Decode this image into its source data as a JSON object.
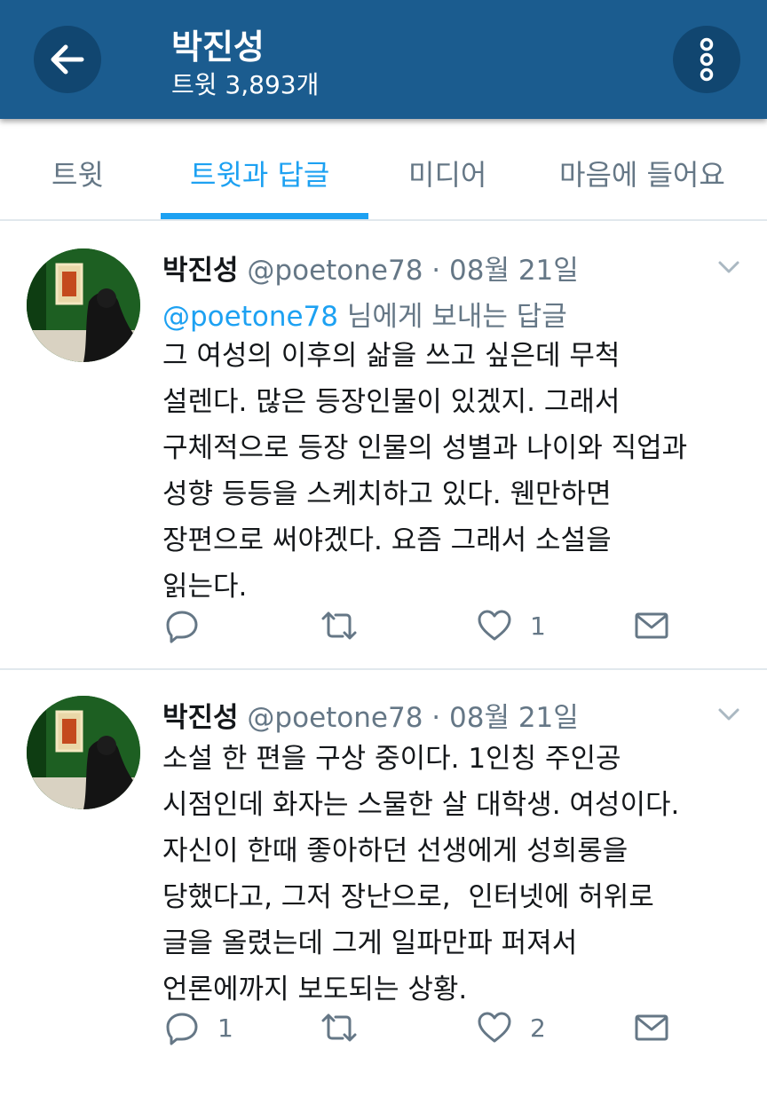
{
  "header": {
    "name": "박진성",
    "tweet_count": "트윗 3,893개",
    "back_icon": "arrow-left-icon",
    "more_icon": "more-vertical-icon"
  },
  "tabs": [
    {
      "label": "트윗",
      "active": false
    },
    {
      "label": "트윗과 답글",
      "active": true
    },
    {
      "label": "미디어",
      "active": false
    },
    {
      "label": "마음에 들어요",
      "active": false
    }
  ],
  "colors": {
    "header_bg": "#1b5c8f",
    "accent": "#1da1f2",
    "muted": "#657786"
  },
  "tweets": [
    {
      "author": "박진성",
      "handle": "@poetone78",
      "date": " · 08월 21일",
      "reply_to_handle": "@poetone78",
      "reply_to_suffix": " 님에게 보내는 답글",
      "lines": [
        "그 여성의 이후의 삶을 쓰고 싶은데 무척",
        "설렌다. 많은 등장인물이 있겠지. 그래서",
        "구체적으로 등장 인물의 성별과 나이와 직업과",
        "성향 등등을 스케치하고 있다. 웬만하면",
        "장편으로 써야겠다. 요즘 그래서 소설을",
        "읽는다."
      ],
      "reply_count": "",
      "retweet_count": "",
      "like_count": "1"
    },
    {
      "author": "박진성",
      "handle": "@poetone78",
      "date": " · 08월 21일",
      "lines": [
        "소설 한 편을 구상 중이다. 1인칭 주인공",
        "시점인데 화자는 스물한 살 대학생. 여성이다.",
        "자신이 한때 좋아하던 선생에게 성희롱을",
        "당했다고, 그저 장난으로,  인터넷에 허위로",
        "글을 올렸는데 그게 일파만파 퍼져서",
        "언론에까지 보도되는 상황."
      ],
      "reply_count": "1",
      "retweet_count": "",
      "like_count": "2"
    }
  ]
}
